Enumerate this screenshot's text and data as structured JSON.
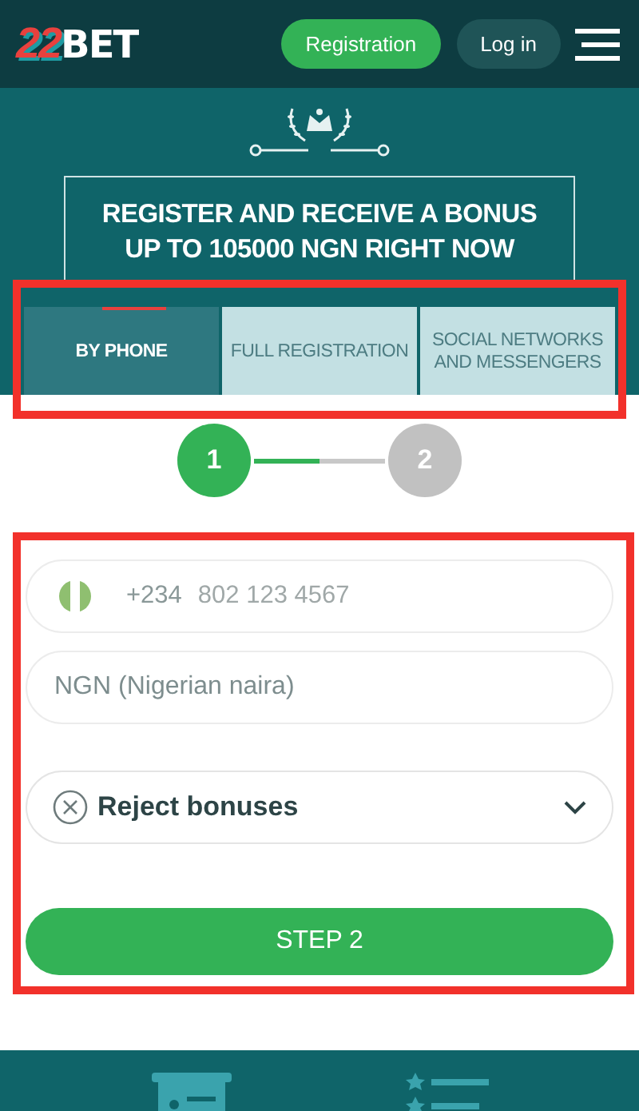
{
  "header": {
    "logo": {
      "digits": "22",
      "word": "BET"
    },
    "buttons": [
      {
        "label": "Registration",
        "kind": "primary"
      },
      {
        "label": "Log in",
        "kind": "secondary"
      }
    ]
  },
  "promo": {
    "lines": [
      "REGISTER AND RECEIVE A BONUS",
      "UP TO 105000 NGN RIGHT NOW"
    ]
  },
  "tabs": [
    {
      "label": "BY PHONE",
      "selected": true
    },
    {
      "label": "FULL REGISTRATION",
      "selected": false
    },
    {
      "label": "SOCIAL NETWORKS AND MESSENGERS",
      "selected": false
    }
  ],
  "steps": [
    {
      "label": "1",
      "selected": true
    },
    {
      "label": "2",
      "selected": false
    }
  ],
  "step_progress": {
    "level": 0.5
  },
  "form": {
    "phone": {
      "country_code": "+234",
      "placeholder": "802 123 4567"
    },
    "currency": {
      "value": "NGN (Nigerian naira)"
    },
    "bonus": {
      "value": "Reject bonuses"
    },
    "submit": "STEP 2"
  }
}
